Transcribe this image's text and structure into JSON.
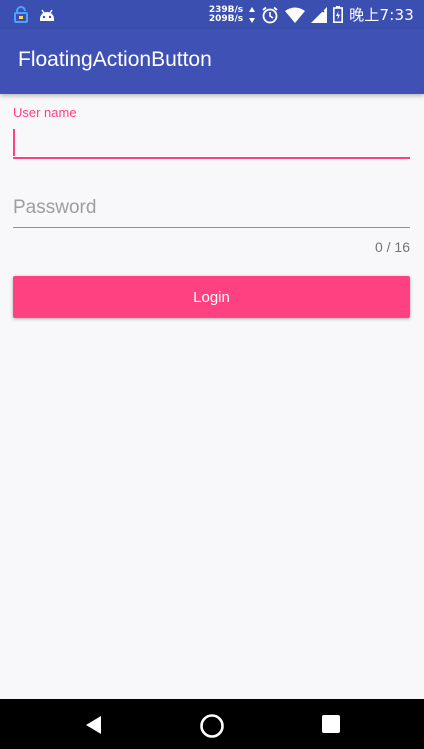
{
  "status_bar": {
    "net_up": "239B/s",
    "net_down": "209B/s",
    "time": "晚上7:33"
  },
  "app_bar": {
    "title": "FloatingActionButton"
  },
  "form": {
    "username_label": "User name",
    "username_value": "",
    "password_placeholder": "Password",
    "password_value": "",
    "password_counter": "0 / 16",
    "login_label": "Login"
  },
  "colors": {
    "primary": "#3f51b5",
    "accent": "#ff4081"
  },
  "icons": {
    "status_left": [
      "lock-app-icon",
      "android-icon"
    ],
    "status_right": [
      "alarm-icon",
      "wifi-icon",
      "signal-off-icon",
      "battery-icon"
    ],
    "nav": [
      "back-icon",
      "home-icon",
      "recents-icon"
    ]
  }
}
